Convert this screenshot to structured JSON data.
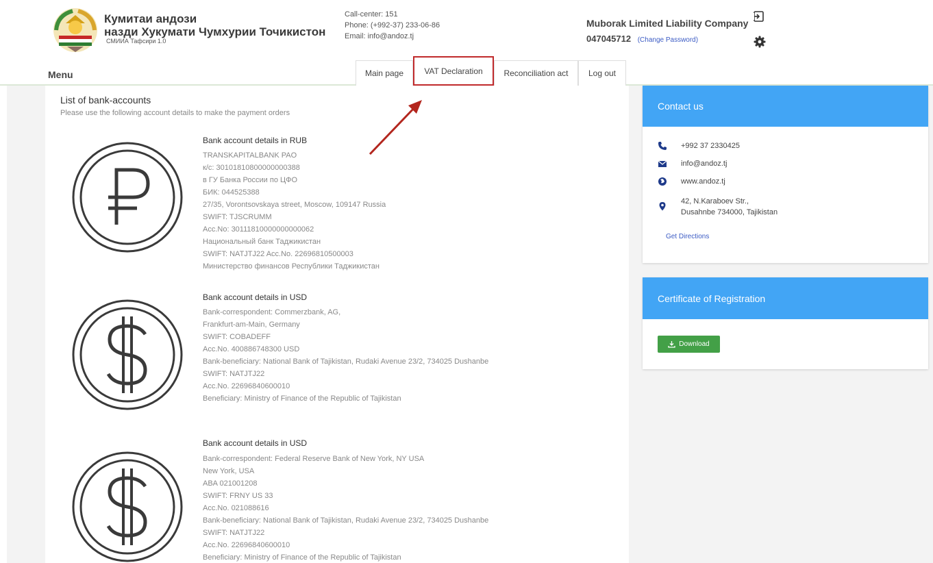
{
  "header": {
    "org_line1": "Кумитаи андози",
    "org_line2": "назди Хукумати Чумхурии Точикистон",
    "org_sub": "СМИИА Тафсири 1.0",
    "call_center": "Call-center: 151",
    "phone": "Phone: (+992-37) 233-06-86",
    "email": "Email: info@andoz.tj",
    "company": "Muborak Limited Liability Company",
    "tin": "047045712",
    "change_password": "(Change Password)"
  },
  "nav": {
    "menu": "Menu",
    "tabs": [
      "Main page",
      "VAT Declaration",
      "Reconciliation act",
      "Log out"
    ]
  },
  "main": {
    "title": "List of bank-accounts",
    "subtitle": "Please use the following account details to make the payment orders",
    "accounts": [
      {
        "title": "Bank account details in RUB",
        "icon": "ruble-coin-icon",
        "lines": [
          "TRANSKAPITALBANK PAO",
          "к/с: 30101810800000000388",
          "в ГУ Банка России по ЦФО",
          "БИК: 044525388",
          "27/35, Vorontsovskaya street, Moscow, 109147 Russia",
          "SWIFT: TJSCRUMM",
          "Acc.No: 30111810000000000062",
          "Национальный банк Таджикистан",
          "SWIFT: NATJTJ22 Acc.No. 22696810500003",
          "Министерство финансов Республики Таджикистан"
        ]
      },
      {
        "title": "Bank account details in USD",
        "icon": "dollar-coin-icon",
        "lines": [
          "Bank-correspondent: Commerzbank, AG,",
          "Frankfurt-am-Main, Germany",
          "SWIFT: COBADEFF",
          "Acc.No. 400886748300 USD",
          "Bank-beneficiary: National Bank of Tajikistan, Rudaki Avenue 23/2, 734025 Dushanbe",
          "SWIFT: NATJTJ22",
          "Acc.No. 22696840600010",
          "Beneficiary: Ministry of Finance of the Republic of Tajikistan"
        ]
      },
      {
        "title": "Bank account details in USD",
        "icon": "dollar-coin-icon",
        "lines": [
          "Bank-correspondent: Federal Reserve Bank of New York, NY USA",
          "New York, USA",
          "ABA 021001208",
          "SWIFT: FRNY US 33",
          "Acc.No. 021088616",
          "Bank-beneficiary: National Bank of Tajikistan, Rudaki Avenue 23/2, 734025 Dushanbe",
          "SWIFT: NATJTJ22",
          "Acc.No. 22696840600010",
          "Beneficiary: Ministry of Finance of the Republic of Tajikistan"
        ]
      }
    ]
  },
  "sidebar": {
    "contact_title": "Contact us",
    "phone": "+992 37 2330425",
    "email": "info@andoz.tj",
    "website": "www.andoz.tj",
    "address1": "42, N.Karaboev Str.,",
    "address2": "Dusahnbe 734000, Tajikistan",
    "get_directions": "Get Directions",
    "cert_title": "Certificate of Registration",
    "download": "Download"
  },
  "colors": {
    "accent_blue": "#42a5f5",
    "download_green": "#43a047",
    "highlight_red": "#c0292b"
  }
}
